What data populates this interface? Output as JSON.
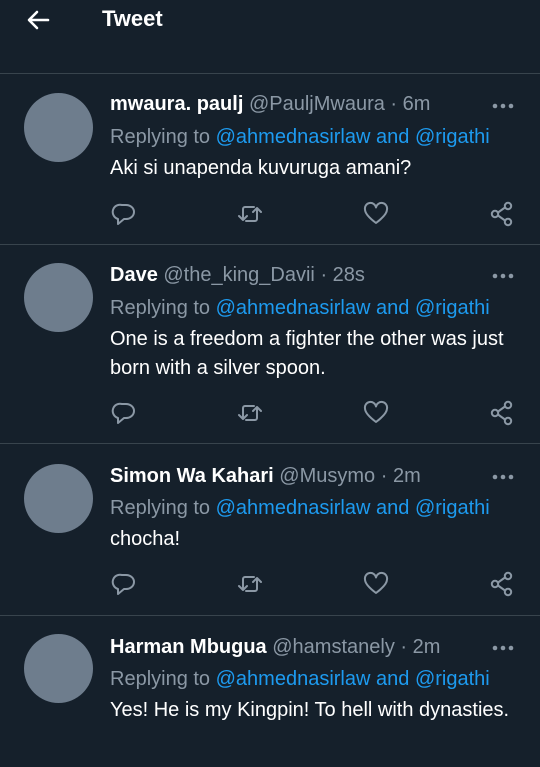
{
  "header": {
    "title": "Tweet",
    "back_icon": "arrow-left-icon"
  },
  "colors": {
    "background": "#15202b",
    "accent": "#1d9bf0",
    "muted": "#8b98a5",
    "divider": "#38444d"
  },
  "tweets": [
    {
      "name": "mwaura. paulj",
      "handle": "@PauljMwaura",
      "sep": "·",
      "time": "6m",
      "reply_prefix": "Replying to",
      "mention1": "@ahmednasirlaw",
      "and": "and",
      "mention2": "@rigathi",
      "text": "Aki si unapenda kuvuruga amani?"
    },
    {
      "name": "Dave",
      "handle": "@the_king_Davii",
      "sep": "·",
      "time": "28s",
      "reply_prefix": "Replying to",
      "mention1": "@ahmednasirlaw",
      "and": "and",
      "mention2": "@rigathi",
      "text": "One is a freedom a fighter the other was just born with a silver spoon."
    },
    {
      "name": "Simon Wa Kahari",
      "handle": "@Musymo",
      "sep": "·",
      "time": "2m",
      "reply_prefix": "Replying to",
      "mention1": "@ahmednasirlaw",
      "and": "and",
      "mention2": "@rigathi",
      "text": "chocha!"
    },
    {
      "name": "Harman Mbugua",
      "handle": "@hamstanely",
      "sep": "·",
      "time": "2m",
      "reply_prefix": "Replying to",
      "mention1": "@ahmednasirlaw",
      "and": "and",
      "mention2": "@rigathi",
      "text": "Yes! He is my Kingpin! To hell with dynasties."
    }
  ],
  "action_icons": [
    "reply-icon",
    "retweet-icon",
    "like-icon",
    "share-icon"
  ]
}
